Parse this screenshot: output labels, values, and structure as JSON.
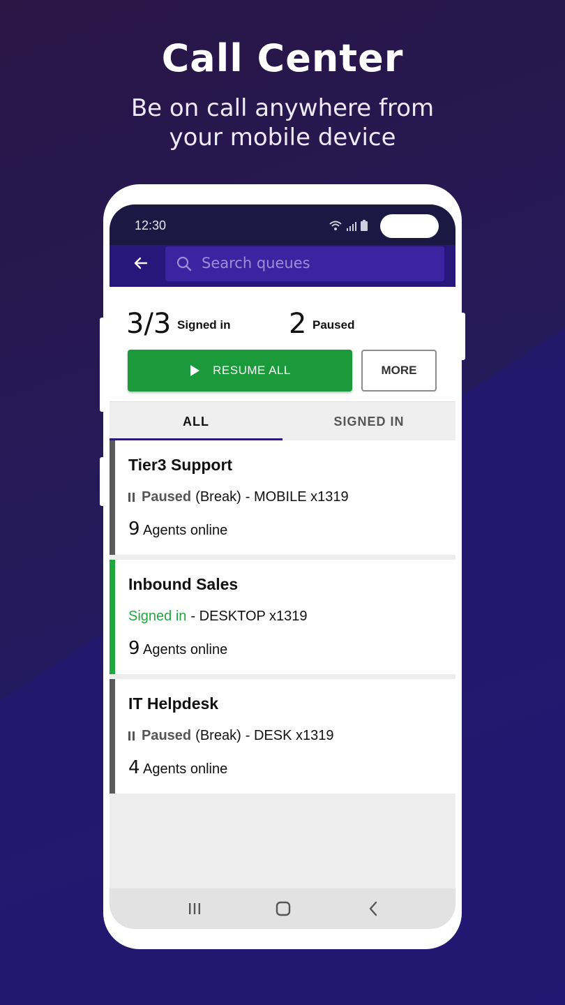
{
  "promo": {
    "title": "Call Center",
    "subtitle_line1": "Be on call anywhere from",
    "subtitle_line2": "your mobile device"
  },
  "statusbar": {
    "time": "12:30"
  },
  "appbar": {
    "back_icon": "arrow-left-icon",
    "search_placeholder": "Search queues"
  },
  "summary": {
    "signed_in_count": "3/3",
    "signed_in_label": "Signed in",
    "paused_count": "2",
    "paused_label": "Paused",
    "resume_label": "RESUME ALL",
    "more_label": "MORE"
  },
  "tabs": [
    {
      "label": "ALL",
      "active": true
    },
    {
      "label": "SIGNED IN",
      "active": false
    }
  ],
  "queues": [
    {
      "name": "Tier3 Support",
      "status": "Paused",
      "reason": "(Break)",
      "device": "- MOBILE x1319",
      "agents_count": "9",
      "agents_label": "Agents online",
      "bar_color": "#5a5a5a"
    },
    {
      "name": "Inbound Sales",
      "status": "Signed in",
      "reason": "",
      "device": "- DESKTOP x1319",
      "agents_count": "9",
      "agents_label": "Agents online",
      "bar_color": "#1fa83e"
    },
    {
      "name": "IT Helpdesk",
      "status": "Paused",
      "reason": "(Break)",
      "device": "- DESK x1319",
      "agents_count": "4",
      "agents_label": "Agents online",
      "bar_color": "#5a5a5a"
    }
  ],
  "colors": {
    "appbar": "#28177a",
    "resume_green": "#1a9a3a",
    "signed_in_green": "#1fa83e"
  }
}
